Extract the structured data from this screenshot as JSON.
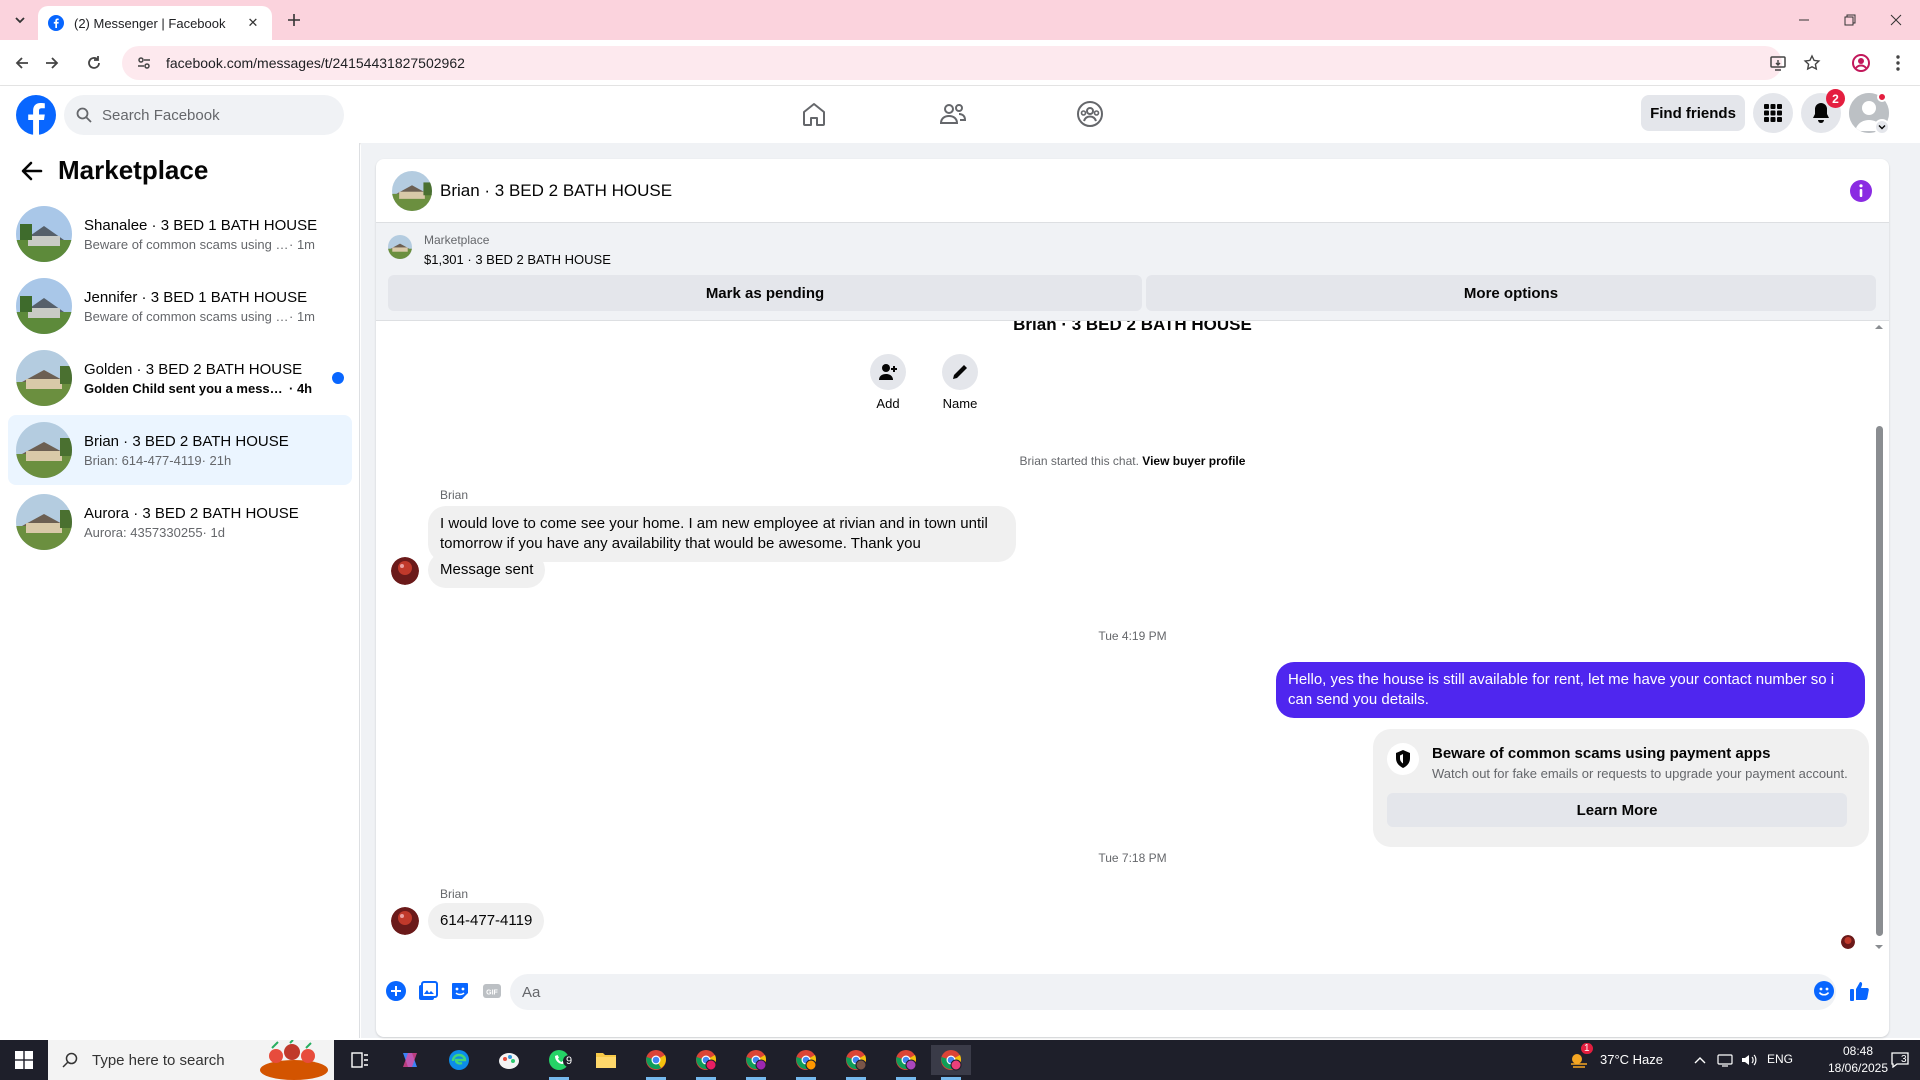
{
  "browser": {
    "tab_title": "(2) Messenger | Facebook",
    "url": "facebook.com/messages/t/24154431827502962"
  },
  "header": {
    "search_placeholder": "Search Facebook",
    "find_friends": "Find friends",
    "notification_count": "2"
  },
  "sidebar": {
    "title": "Marketplace",
    "conversations": [
      {
        "name": "Shanalee · 3 BED 1 BATH HOUSE",
        "snippet": "Beware of common scams using pay...",
        "time": " · 1m",
        "unread": false,
        "active": false
      },
      {
        "name": "Jennifer · 3 BED 1 BATH HOUSE",
        "snippet": "Beware of common scams using pay...",
        "time": " · 1m",
        "unread": false,
        "active": false
      },
      {
        "name": "Golden · 3 BED 2 BATH HOUSE",
        "snippet": "Golden Child sent you a message a...",
        "time": " · 4h",
        "unread": true,
        "active": false
      },
      {
        "name": "Brian · 3 BED 2 BATH HOUSE",
        "snippet": "Brian: 614-477-4119",
        "time": " · 21h",
        "unread": false,
        "active": true
      },
      {
        "name": "Aurora · 3 BED 2 BATH HOUSE",
        "snippet": "Aurora: 4357330255",
        "time": " · 1d",
        "unread": false,
        "active": false
      }
    ]
  },
  "chat": {
    "title": "Brian · 3 BED 2 BATH HOUSE",
    "marketplace_label": "Marketplace",
    "listing": "$1,301 · 3 BED 2 BATH HOUSE",
    "mark_pending": "Mark as pending",
    "more_options": "More options",
    "thread_title": "Brian · 3 BED 2 BATH HOUSE",
    "add_label": "Add",
    "name_label": "Name",
    "started_text": "Brian started this chat.",
    "view_profile": "View buyer profile",
    "sender_name": "Brian",
    "msg1_line1": "I would love to come see your home.  I am new employee at rivian and in town until",
    "msg1_line2": "tomorrow if you have any availability that would be awesome.  Thank you",
    "msg2": "Message sent",
    "time1": "Tue 4:19 PM",
    "out_line1": "Hello, yes the house is still available for rent, let me have your contact number so i",
    "out_line2": "can send you details.",
    "scam_title": "Beware of common scams using payment apps",
    "scam_sub": "Watch out for fake emails or requests to upgrade your payment account.",
    "learn_more": "Learn More",
    "time2": "Tue 7:18 PM",
    "msg3": "614-477-4119",
    "composer_placeholder": "Aa"
  },
  "taskbar": {
    "search_placeholder": "Type here to search",
    "whatsapp_badge": "9",
    "weather_badge": "1",
    "temperature": "37°C  Haze",
    "language": "ENG",
    "time": "08:48",
    "date": "18/06/2025",
    "notification_count": "3"
  },
  "colors": {
    "facebook_blue": "#0866ff",
    "outgoing_bubble": "#4f26ef",
    "chrome_tabbar": "#fbd3dd",
    "info_purple": "#8a2be2"
  },
  "icons": [
    "facebook-logo-icon",
    "search-icon",
    "home-icon",
    "friends-icon",
    "groups-icon",
    "menu-grid-icon",
    "bell-icon",
    "back-arrow-icon",
    "info-icon",
    "add-person-icon",
    "pencil-icon",
    "shield-icon",
    "plus-icon",
    "photo-icon",
    "sticker-icon",
    "gif-icon",
    "emoji-icon",
    "thumbs-up-icon"
  ]
}
